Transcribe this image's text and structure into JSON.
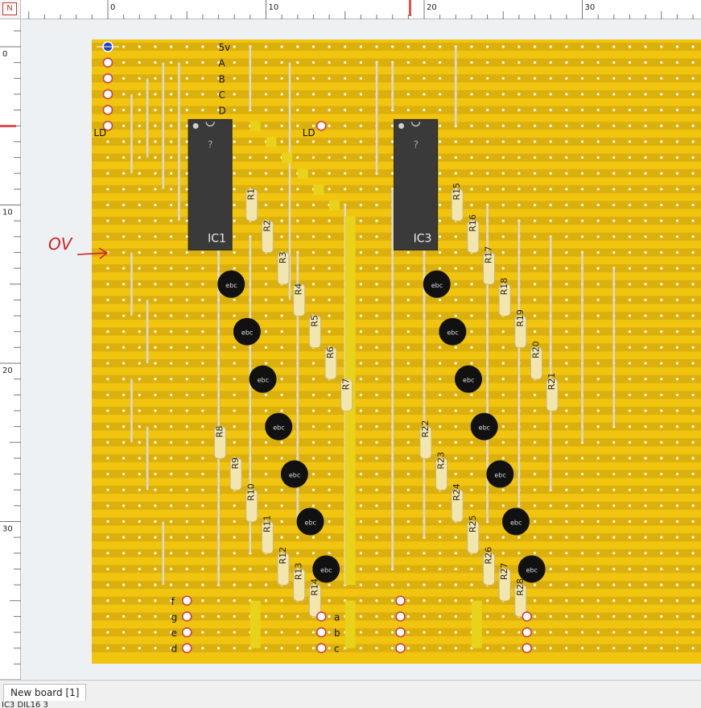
{
  "corner": {
    "label": "N"
  },
  "ruler_top": {
    "ticks": [
      "0",
      "10",
      "20",
      "30"
    ]
  },
  "ruler_left": {
    "ticks": [
      "0",
      "10",
      "20",
      "30"
    ]
  },
  "annotation": {
    "label": "OV"
  },
  "ics": [
    {
      "name": "IC1",
      "glyph": "?"
    },
    {
      "name": "IC3",
      "glyph": "?"
    }
  ],
  "resistors": [
    "R1",
    "R2",
    "R3",
    "R4",
    "R5",
    "R6",
    "R7",
    "R8",
    "R9",
    "R10",
    "R11",
    "R12",
    "R13",
    "R14",
    "R15",
    "R16",
    "R17",
    "R18",
    "R19",
    "R20",
    "R21",
    "R22",
    "R23",
    "R24",
    "R25",
    "R26",
    "R27",
    "R28"
  ],
  "transistor_pins": "ebc",
  "labels_top": [
    "5v",
    "A",
    "B",
    "C",
    "D"
  ],
  "labels_ld": [
    "LD",
    "LD"
  ],
  "labels_bottom_left": [
    "f",
    "g",
    "e",
    "d"
  ],
  "labels_bottom_mid": [
    "a",
    "b",
    "c"
  ],
  "colors": {
    "board": "#f1c40f",
    "strip": "#c9a10b",
    "accent": "#e8d21a",
    "chip": "#3a3a3a"
  },
  "tabs": [
    {
      "label": "New board [1]"
    }
  ],
  "status": {
    "text": "IC3 DIL16 3"
  }
}
